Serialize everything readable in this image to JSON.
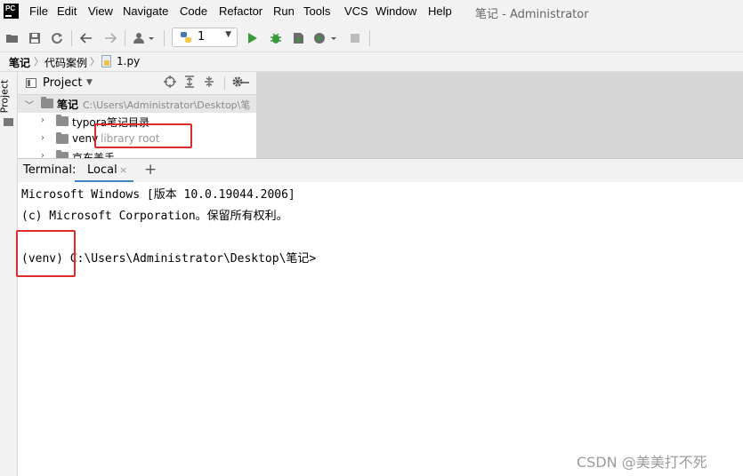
{
  "menubar": {
    "logo": "PC",
    "items": [
      "File",
      "Edit",
      "View",
      "Navigate",
      "Code",
      "Refactor",
      "Run",
      "Tools",
      "VCS",
      "Window",
      "Help"
    ],
    "window_title": "笔记 - Administrator"
  },
  "toolbar": {
    "run_config_label": "1"
  },
  "breadcrumb": {
    "items": [
      "笔记",
      "代码案例",
      "1.py"
    ]
  },
  "left_strip": {
    "label": "Project"
  },
  "project_panel": {
    "title": "Project",
    "tree": [
      {
        "name": "笔记",
        "path": "C:\\Users\\Administrator\\Desktop\\笔"
      },
      {
        "name": "typora笔记目录"
      },
      {
        "name": "venv",
        "tag": "library root"
      },
      {
        "name": "京东美手"
      }
    ]
  },
  "terminal": {
    "label": "Terminal:",
    "tab": "Local",
    "close_glyph": "×",
    "add_glyph": "+",
    "lines": [
      "Microsoft Windows [版本 10.0.19044.2006]",
      "(c) Microsoft Corporation。保留所有权利。",
      "",
      "(venv) C:\\Users\\Administrator\\Desktop\\笔记>"
    ]
  },
  "watermark": "CSDN @美美打不死",
  "colors": {
    "chrome": "#f2f2f2",
    "accent": "#4083c9",
    "annotation": "#e02b2b",
    "run_green": "#3b9a3b"
  }
}
